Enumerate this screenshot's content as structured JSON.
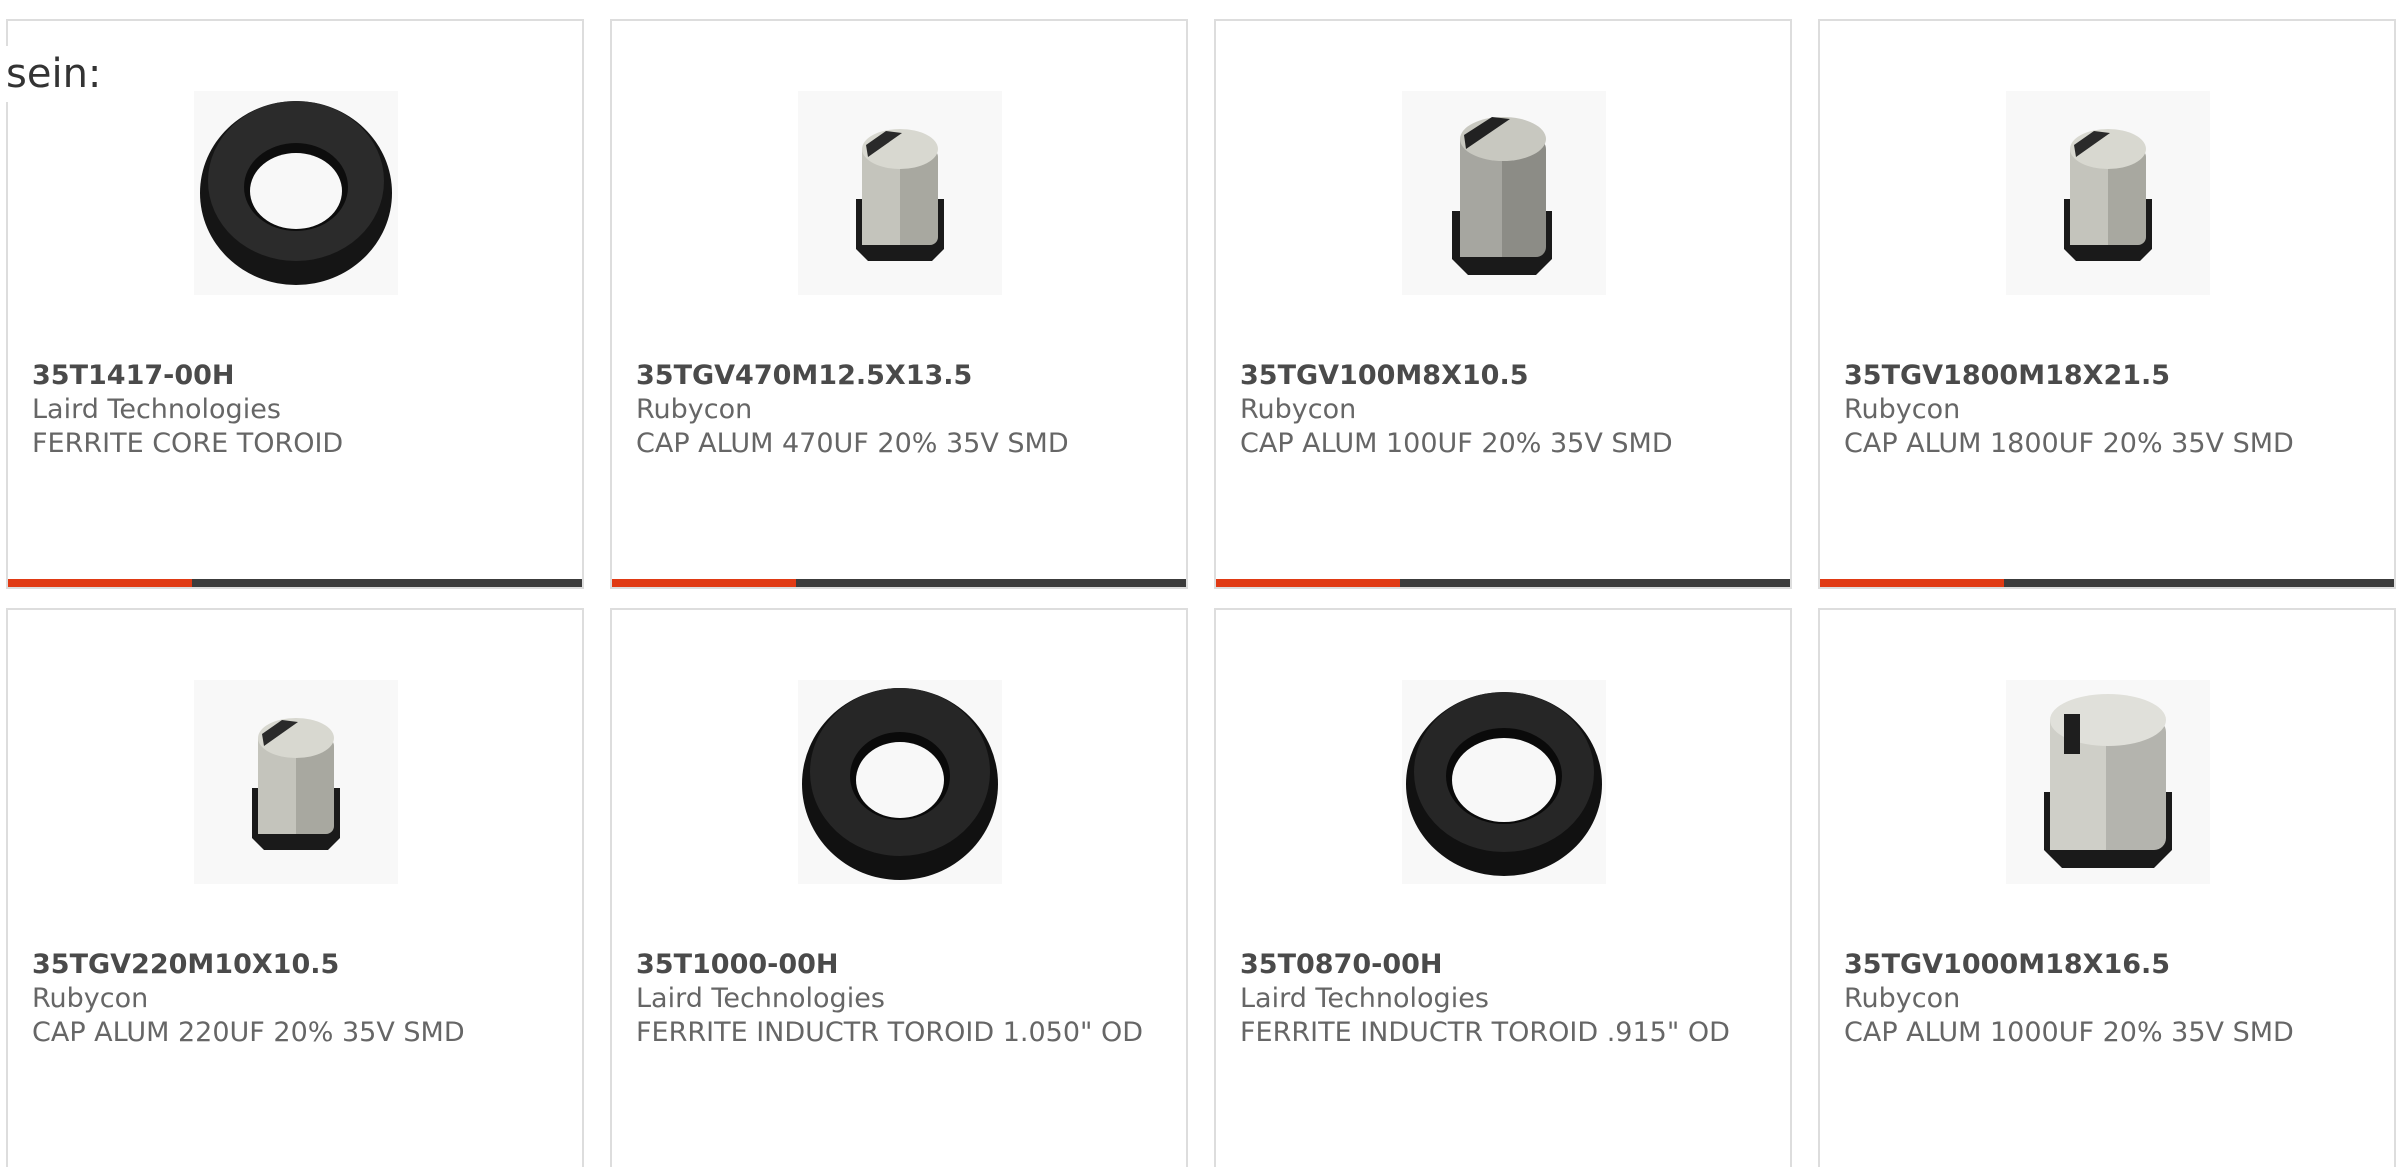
{
  "intro_text": "sein:",
  "products": [
    {
      "part": "35T1417-00H",
      "brand": "Laird Technologies",
      "desc": "FERRITE CORE TOROID",
      "image_icon": "ferrite-toroid-icon",
      "progress_percent": 32
    },
    {
      "part": "35TGV470M12.5X13.5",
      "brand": "Rubycon",
      "desc": "CAP ALUM 470UF 20% 35V SMD",
      "image_icon": "smd-capacitor-icon",
      "progress_percent": 32
    },
    {
      "part": "35TGV100M8X10.5",
      "brand": "Rubycon",
      "desc": "CAP ALUM 100UF 20% 35V SMD",
      "image_icon": "smd-capacitor-icon",
      "progress_percent": 32
    },
    {
      "part": "35TGV1800M18X21.5",
      "brand": "Rubycon",
      "desc": "CAP ALUM 1800UF 20% 35V SMD",
      "image_icon": "smd-capacitor-icon",
      "progress_percent": 32
    },
    {
      "part": "35TGV220M10X10.5",
      "brand": "Rubycon",
      "desc": "CAP ALUM 220UF 20% 35V SMD",
      "image_icon": "smd-capacitor-icon"
    },
    {
      "part": "35T1000-00H",
      "brand": "Laird Technologies",
      "desc": "FERRITE INDUCTR TOROID 1.050\" OD",
      "image_icon": "ferrite-toroid-icon"
    },
    {
      "part": "35T0870-00H",
      "brand": "Laird Technologies",
      "desc": "FERRITE INDUCTR TOROID .915\" OD",
      "image_icon": "ferrite-toroid-icon"
    },
    {
      "part": "35TGV1000M18X16.5",
      "brand": "Rubycon",
      "desc": "CAP ALUM 1000UF 20% 35V SMD",
      "image_icon": "smd-capacitor-icon"
    }
  ],
  "colors": {
    "accent": "#e03a14",
    "bar_track": "#3c3c3c",
    "border": "#dddddd"
  }
}
